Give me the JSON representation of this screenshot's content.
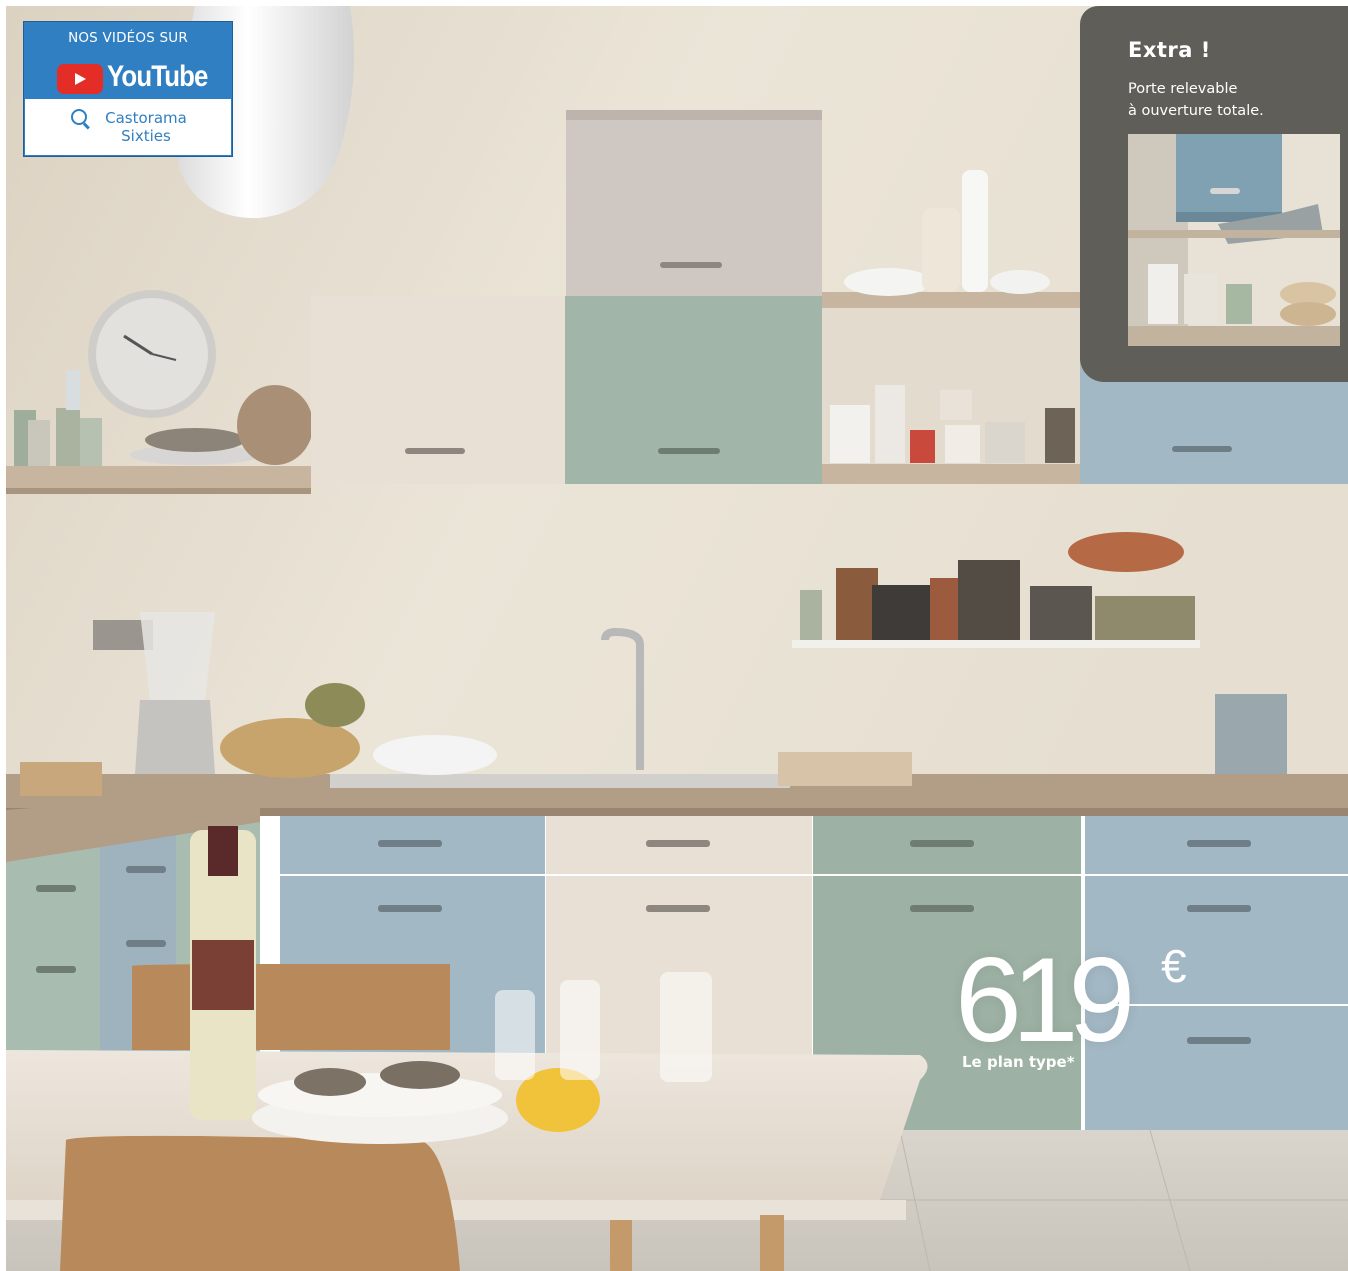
{
  "youtube_badge": {
    "top_text": "NOS VIDÉOS SUR",
    "logo_text": "YouTube",
    "search_icon": "search-icon",
    "search_text_line1": "Castorama",
    "search_text_line2": "Sixties"
  },
  "extra_panel": {
    "title": "Extra !",
    "description_line1": "Porte relevable",
    "description_line2": "à ouverture totale."
  },
  "price": {
    "amount": "619",
    "currency": "€",
    "label": "Le plan type*"
  },
  "colors": {
    "youtube_blue": "#2f7fc2",
    "youtube_red": "#e52d27",
    "panel_grey": "#5f5e59",
    "cabinet_sage": "#9db1a4",
    "cabinet_blue": "#a2b8c4",
    "cabinet_cream": "#e8e0d4",
    "cabinet_taupe": "#cfc7c1",
    "wall": "#e9e3d6",
    "worktop": "#b29d86"
  }
}
